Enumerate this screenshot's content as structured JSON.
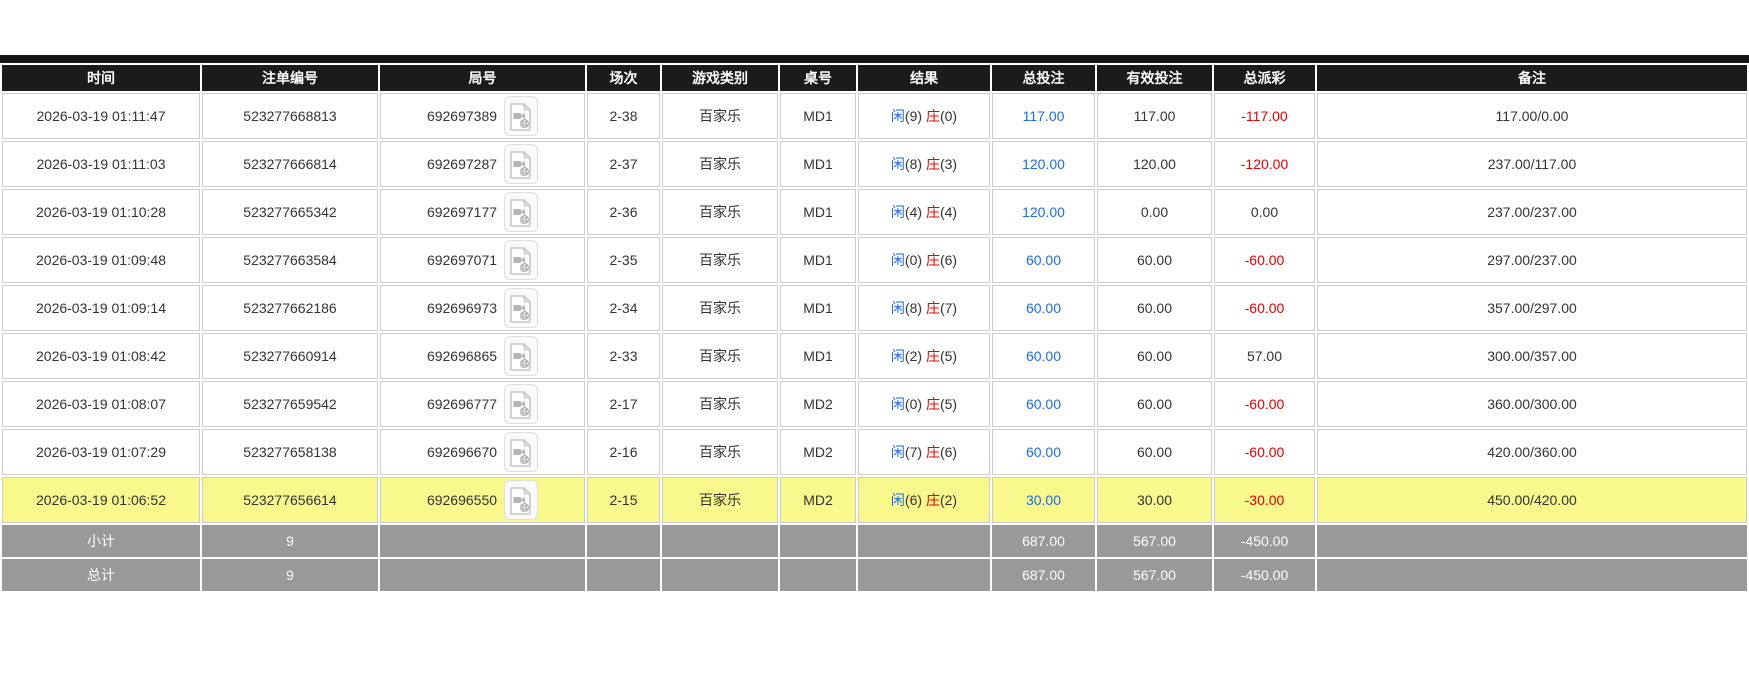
{
  "labels": {
    "player": "闲",
    "banker": "庄"
  },
  "icons": {
    "video_replay": "video-file-icon"
  },
  "colors": {
    "accent_blue": "#1b6ee0",
    "negative_red": "#e60000",
    "header_black": "#1b1b1b",
    "footer_gray": "#999999",
    "highlight_yellow": "#f9f88d"
  },
  "columns": [
    {
      "key": "time",
      "label": "时间"
    },
    {
      "key": "bet_id",
      "label": "注单编号"
    },
    {
      "key": "round_id",
      "label": "局号"
    },
    {
      "key": "session",
      "label": "场次"
    },
    {
      "key": "game",
      "label": "游戏类别"
    },
    {
      "key": "table",
      "label": "桌号"
    },
    {
      "key": "result",
      "label": "结果"
    },
    {
      "key": "total_bet",
      "label": "总投注"
    },
    {
      "key": "valid_bet",
      "label": "有效投注"
    },
    {
      "key": "payout",
      "label": "总派彩"
    },
    {
      "key": "remark",
      "label": "备注"
    }
  ],
  "rows": [
    {
      "time": "2026-03-19 01:11:47",
      "bet_id": "523277668813",
      "round_id": "692697389",
      "session": "2-38",
      "game": "百家乐",
      "table": "MD1",
      "result": {
        "player_score": "(9)",
        "banker_score": "(0)"
      },
      "total_bet": "117.00",
      "valid_bet": "117.00",
      "payout": "-117.00",
      "payout_negative": true,
      "remark": "117.00/0.00",
      "highlighted": false
    },
    {
      "time": "2026-03-19 01:11:03",
      "bet_id": "523277666814",
      "round_id": "692697287",
      "session": "2-37",
      "game": "百家乐",
      "table": "MD1",
      "result": {
        "player_score": "(8)",
        "banker_score": "(3)"
      },
      "total_bet": "120.00",
      "valid_bet": "120.00",
      "payout": "-120.00",
      "payout_negative": true,
      "remark": "237.00/117.00",
      "highlighted": false
    },
    {
      "time": "2026-03-19 01:10:28",
      "bet_id": "523277665342",
      "round_id": "692697177",
      "session": "2-36",
      "game": "百家乐",
      "table": "MD1",
      "result": {
        "player_score": "(4)",
        "banker_score": "(4)"
      },
      "total_bet": "120.00",
      "valid_bet": "0.00",
      "payout": "0.00",
      "payout_negative": false,
      "remark": "237.00/237.00",
      "highlighted": false
    },
    {
      "time": "2026-03-19 01:09:48",
      "bet_id": "523277663584",
      "round_id": "692697071",
      "session": "2-35",
      "game": "百家乐",
      "table": "MD1",
      "result": {
        "player_score": "(0)",
        "banker_score": "(6)"
      },
      "total_bet": "60.00",
      "valid_bet": "60.00",
      "payout": "-60.00",
      "payout_negative": true,
      "remark": "297.00/237.00",
      "highlighted": false
    },
    {
      "time": "2026-03-19 01:09:14",
      "bet_id": "523277662186",
      "round_id": "692696973",
      "session": "2-34",
      "game": "百家乐",
      "table": "MD1",
      "result": {
        "player_score": "(8)",
        "banker_score": "(7)"
      },
      "total_bet": "60.00",
      "valid_bet": "60.00",
      "payout": "-60.00",
      "payout_negative": true,
      "remark": "357.00/297.00",
      "highlighted": false
    },
    {
      "time": "2026-03-19 01:08:42",
      "bet_id": "523277660914",
      "round_id": "692696865",
      "session": "2-33",
      "game": "百家乐",
      "table": "MD1",
      "result": {
        "player_score": "(2)",
        "banker_score": "(5)"
      },
      "total_bet": "60.00",
      "valid_bet": "60.00",
      "payout": "57.00",
      "payout_negative": false,
      "remark": "300.00/357.00",
      "highlighted": false
    },
    {
      "time": "2026-03-19 01:08:07",
      "bet_id": "523277659542",
      "round_id": "692696777",
      "session": "2-17",
      "game": "百家乐",
      "table": "MD2",
      "result": {
        "player_score": "(0)",
        "banker_score": "(5)"
      },
      "total_bet": "60.00",
      "valid_bet": "60.00",
      "payout": "-60.00",
      "payout_negative": true,
      "remark": "360.00/300.00",
      "highlighted": false
    },
    {
      "time": "2026-03-19 01:07:29",
      "bet_id": "523277658138",
      "round_id": "692696670",
      "session": "2-16",
      "game": "百家乐",
      "table": "MD2",
      "result": {
        "player_score": "(7)",
        "banker_score": "(6)"
      },
      "total_bet": "60.00",
      "valid_bet": "60.00",
      "payout": "-60.00",
      "payout_negative": true,
      "remark": "420.00/360.00",
      "highlighted": false
    },
    {
      "time": "2026-03-19 01:06:52",
      "bet_id": "523277656614",
      "round_id": "692696550",
      "session": "2-15",
      "game": "百家乐",
      "table": "MD2",
      "result": {
        "player_score": "(6)",
        "banker_score": "(2)"
      },
      "total_bet": "30.00",
      "valid_bet": "30.00",
      "payout": "-30.00",
      "payout_negative": true,
      "remark": "450.00/420.00",
      "highlighted": true
    }
  ],
  "footer_rows": [
    {
      "label": "小计",
      "count": "9",
      "total_bet": "687.00",
      "valid_bet": "567.00",
      "payout": "-450.00",
      "payout_negative": true
    },
    {
      "label": "总计",
      "count": "9",
      "total_bet": "687.00",
      "valid_bet": "567.00",
      "payout": "-450.00",
      "payout_negative": true
    }
  ]
}
